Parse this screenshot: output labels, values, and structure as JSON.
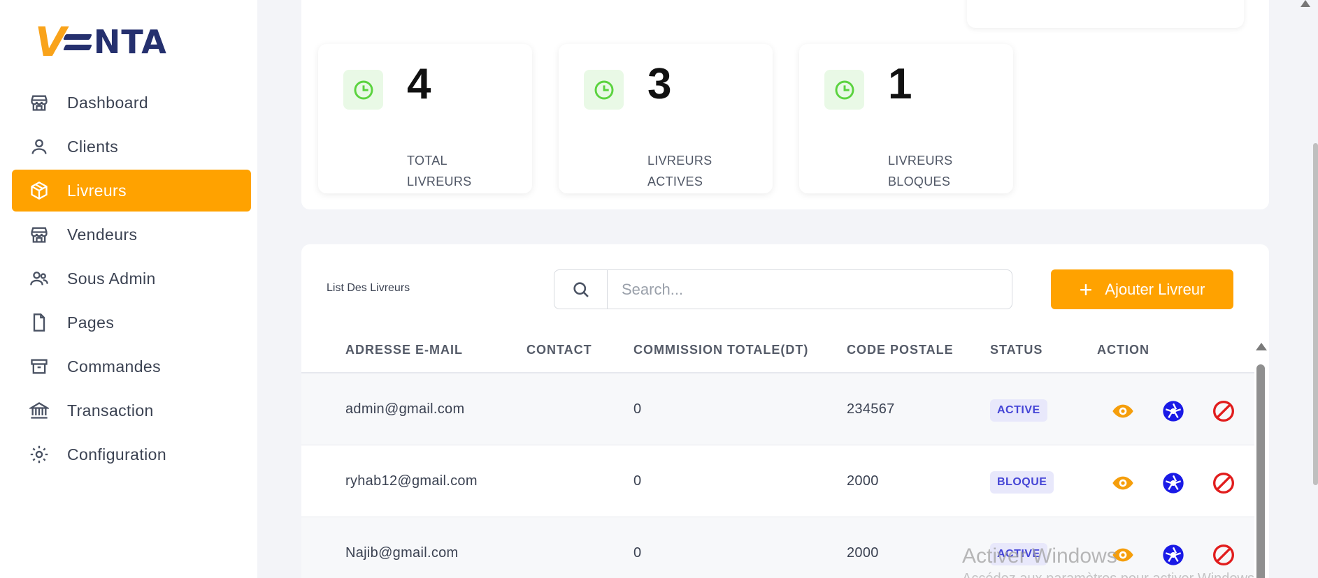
{
  "brand": {
    "logo_text": "NTA",
    "logo_v": "V"
  },
  "sidebar": {
    "items": [
      {
        "label": "Dashboard",
        "icon": "store-icon",
        "active": false
      },
      {
        "label": "Clients",
        "icon": "user-icon",
        "active": false
      },
      {
        "label": "Livreurs",
        "icon": "box-icon",
        "active": true
      },
      {
        "label": "Vendeurs",
        "icon": "store-icon",
        "active": false
      },
      {
        "label": "Sous Admin",
        "icon": "users-icon",
        "active": false
      },
      {
        "label": "Pages",
        "icon": "file-icon",
        "active": false
      },
      {
        "label": "Commandes",
        "icon": "archive-icon",
        "active": false
      },
      {
        "label": "Transaction",
        "icon": "bank-icon",
        "active": false
      },
      {
        "label": "Configuration",
        "icon": "gear-icon",
        "active": false
      }
    ]
  },
  "stats": [
    {
      "value": "4",
      "label": "TOTAL LIVREURS",
      "icon": "clock-icon"
    },
    {
      "value": "3",
      "label": "LIVREURS ACTIVES",
      "icon": "clock-icon"
    },
    {
      "value": "1",
      "label": "LIVREURS BLOQUES",
      "icon": "clock-icon"
    }
  ],
  "list": {
    "title": "List Des Livreurs",
    "search": {
      "placeholder": "Search...",
      "value": ""
    },
    "add_button_label": "Ajouter Livreur",
    "columns": [
      "ADRESSE E-MAIL",
      "CONTACT",
      "COMMISSION TOTALE(DT)",
      "CODE POSTALE",
      "STATUS",
      "ACTION"
    ],
    "rows": [
      {
        "email": "admin@gmail.com",
        "contact": "",
        "commission": "0",
        "code_postale": "234567",
        "status": "ACTIVE"
      },
      {
        "email": "ryhab12@gmail.com",
        "contact": "",
        "commission": "0",
        "code_postale": "2000",
        "status": "BLOQUE"
      },
      {
        "email": "Najib@gmail.com",
        "contact": "",
        "commission": "0",
        "code_postale": "2000",
        "status": "ACTIVE"
      }
    ]
  },
  "colors": {
    "accent": "#ffa200",
    "brand_navy": "#25306e",
    "stat_icon": "#5bd33f",
    "view_icon": "#f59e0b",
    "edit_icon": "#1a1ae6",
    "block_icon": "#e11d1d"
  },
  "watermark": {
    "title": "Activer Windows",
    "subtitle": "Accédez aux paramètres pour activer Windows."
  }
}
